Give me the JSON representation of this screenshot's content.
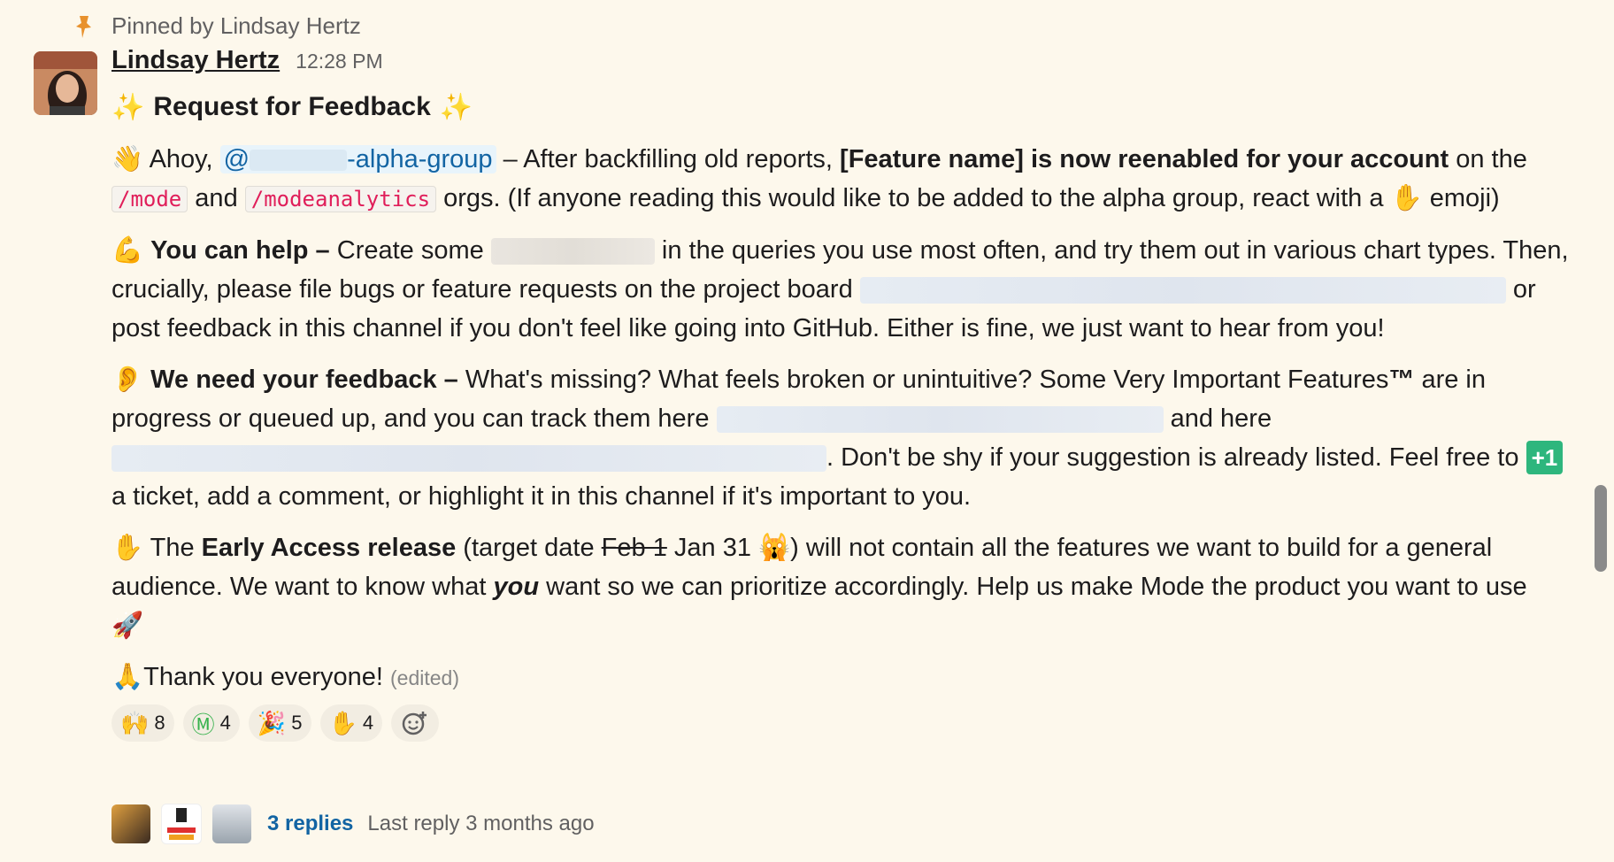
{
  "pinned": {
    "text": "Pinned by Lindsay Hertz"
  },
  "message": {
    "author": "Lindsay Hertz",
    "time": "12:28 PM",
    "title_spark_left": "✨",
    "title": "Request for Feedback",
    "title_spark_right": "✨",
    "p1": {
      "emoji": "👋",
      "greet": "Ahoy,",
      "mention_at": "@",
      "mention_suffix": "-alpha-group",
      "t1": " – After backfilling old reports, ",
      "bold": "[Feature name]  is now reenabled for your account",
      "t2": " on the",
      "code1": "/mode",
      "and": " and ",
      "code2": "/modeanalytics",
      "t3": " orgs. (If anyone reading this would like to be added to the alpha group, react with a ",
      "hand": "✋",
      "t4": " emoji)"
    },
    "p2": {
      "emoji": "💪",
      "bold": "You can help –",
      "t1": " Create some ",
      "t2": " in the queries you use most often, and try them out in various chart types. Then, crucially, please file bugs or feature requests on the project board",
      "t3": " or post feedback in this channel if you don't feel like going into GitHub. Either is fine, we just want to hear from you!"
    },
    "p3": {
      "emoji": "👂",
      "bold": "We need your feedback –",
      "t1": " What's missing? What feels broken or unintuitive? Some Very Important Features",
      "tm": "™",
      "t2": " are in progress or queued up, and you can track them here ",
      "t3": " and here",
      "t4": ". Don't be shy if your suggestion is already listed. Feel free to ",
      "plus": "+1",
      "t5": " a ticket, add a comment, or highlight it in this channel if it's important to you."
    },
    "p4": {
      "emoji": "✋",
      "t1": " The ",
      "bold": "Early Access release",
      "t2": " (target date ",
      "strike": "Feb 1",
      "t3": " Jan 31 ",
      "scream": "🙀",
      "t4": ") will not contain all the features we want to build for a general audience. We want to know what ",
      "italic": "you",
      "t5": " want so we can prioritize accordingly. Help us make Mode the product you want to use",
      "rocket": "🚀"
    },
    "p5": {
      "emoji": "🙏",
      "text": "Thank you everyone!",
      "edited": "(edited)"
    },
    "reactions": [
      {
        "emoji": "🙌",
        "count": "8"
      },
      {
        "emoji": "Ⓜ",
        "count": "4"
      },
      {
        "emoji": "🎉",
        "count": "5"
      },
      {
        "emoji": "✋",
        "count": "4"
      }
    ],
    "add_reaction_icon": "add-reaction-icon",
    "thread": {
      "replies": "3 replies",
      "last_reply": "Last reply 3 months ago"
    }
  }
}
